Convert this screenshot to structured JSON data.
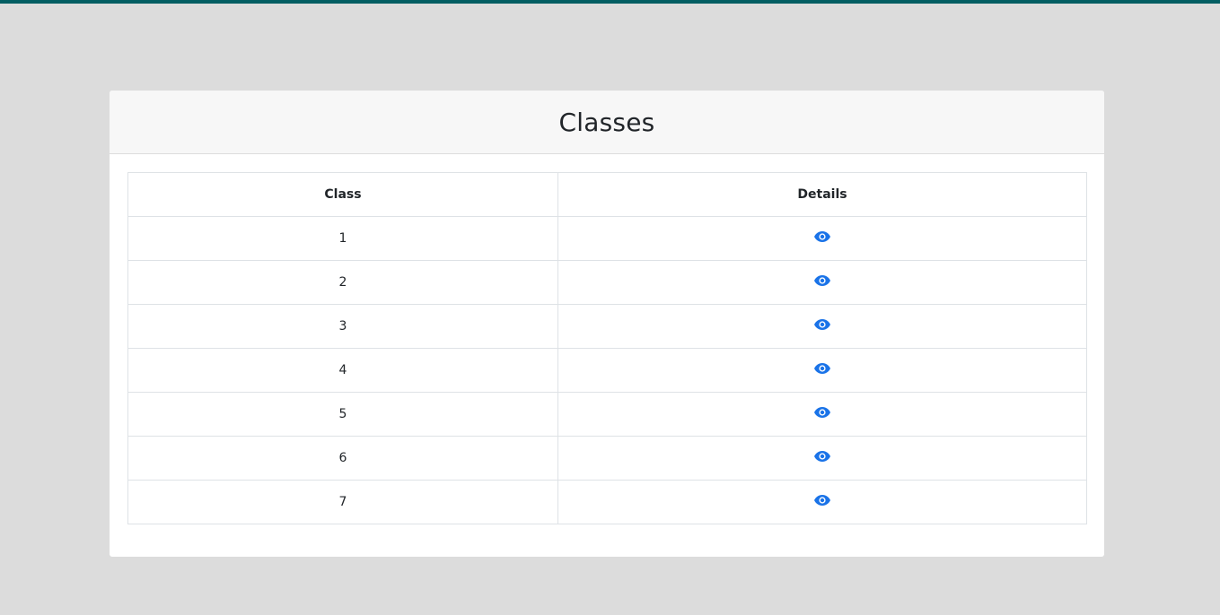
{
  "page": {
    "title": "Classes"
  },
  "table": {
    "headers": {
      "class": "Class",
      "details": "Details"
    },
    "rows": [
      {
        "class": "1",
        "details_icon": "eye-icon"
      },
      {
        "class": "2",
        "details_icon": "eye-icon"
      },
      {
        "class": "3",
        "details_icon": "eye-icon"
      },
      {
        "class": "4",
        "details_icon": "eye-icon"
      },
      {
        "class": "5",
        "details_icon": "eye-icon"
      },
      {
        "class": "6",
        "details_icon": "eye-icon"
      },
      {
        "class": "7",
        "details_icon": "eye-icon"
      }
    ]
  },
  "colors": {
    "top_bar": "#035e63",
    "background": "#dcdcdc",
    "icon": "#1a73e8"
  }
}
